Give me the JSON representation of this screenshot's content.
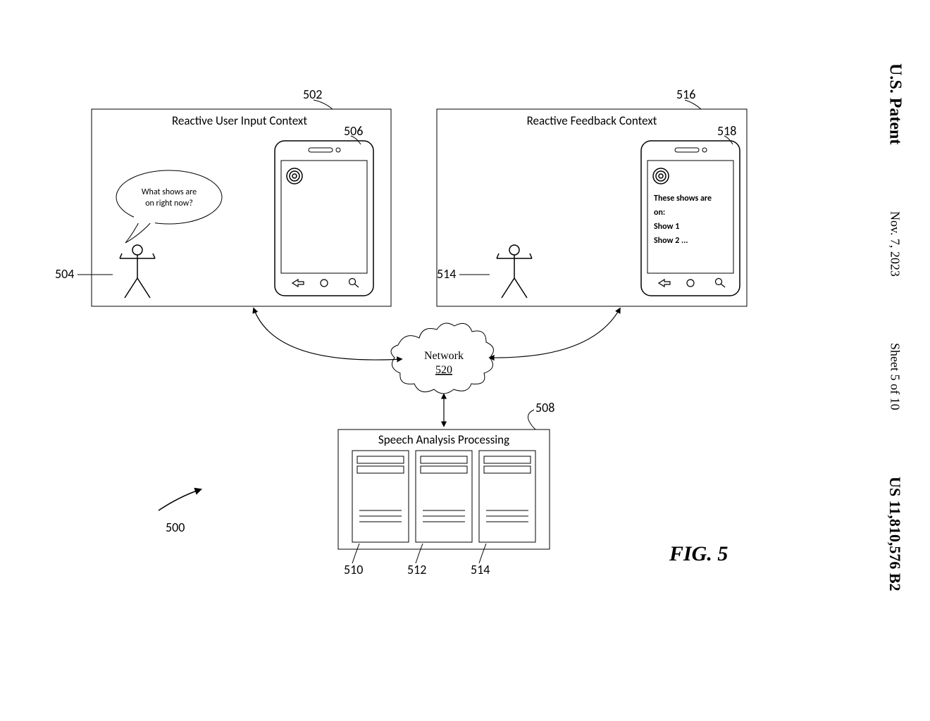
{
  "sidebar": {
    "header": "U.S. Patent",
    "date": "Nov. 7, 2023",
    "sheet": "Sheet 5 of 10",
    "patent_num": "US 11,810,576 B2"
  },
  "figure_label": "FIG. 5",
  "boxes": {
    "left": {
      "title": "Reactive User Input Context"
    },
    "right": {
      "title": "Reactive Feedback Context"
    },
    "bottom": {
      "title": "Speech Analysis Processing"
    }
  },
  "speech_bubble": {
    "line1": "What shows are",
    "line2": "on right now?"
  },
  "phone_text": {
    "l1": "These shows are",
    "l2": "on:",
    "l3": "Show 1",
    "l4": "Show 2 ..."
  },
  "network": {
    "label": "Network",
    "num": "520"
  },
  "refs": {
    "r500": "500",
    "r502": "502",
    "r504": "504",
    "r506": "506",
    "r508": "508",
    "r510": "510",
    "r512": "512",
    "r514_box": "514",
    "r514_server": "514",
    "r516": "516",
    "r518": "518"
  }
}
